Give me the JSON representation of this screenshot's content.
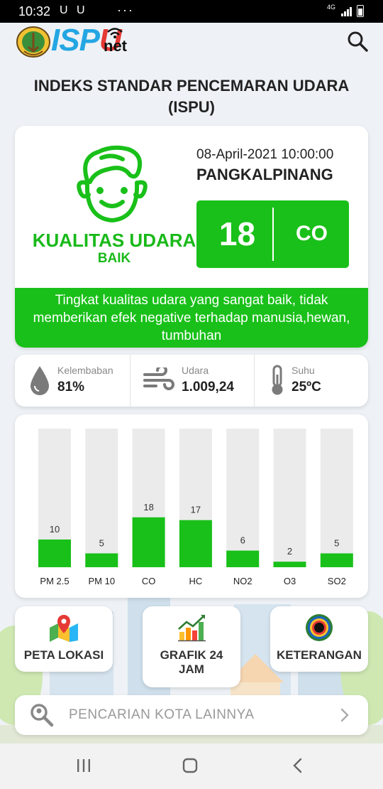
{
  "status_bar": {
    "time": "10:32",
    "indicators": "U U",
    "more": "···",
    "network": "4G"
  },
  "app": {
    "logo_text_1": "ISP",
    "logo_text_2": "U",
    "logo_suffix": "net",
    "search_icon": "search-icon"
  },
  "page_title": "INDEKS STANDAR PENCEMARAN UDARA (ISPU)",
  "air_quality": {
    "label": "KUALITAS UDARA",
    "category": "BAIK",
    "datetime": "08-April-2021 10:00:00",
    "city": "PANGKALPINANG",
    "ispu_value": "18",
    "dominant_param": "CO",
    "description": "Tingkat kualitas udara yang sangat baik, tidak memberikan efek negative terhadap manusia,hewan, tumbuhan",
    "status_color": "#19c019"
  },
  "weather": {
    "humidity_label": "Kelembaban",
    "humidity_value": "81%",
    "pressure_label": "Udara",
    "pressure_value": "1.009,24",
    "temp_label": "Suhu",
    "temp_value": "25ºC"
  },
  "chart_data": {
    "type": "bar",
    "categories": [
      "PM 2.5",
      "PM 10",
      "CO",
      "HC",
      "NO2",
      "O3",
      "SO2"
    ],
    "values": [
      10,
      5,
      18,
      17,
      6,
      2,
      5
    ],
    "ylim": [
      0,
      50
    ],
    "bar_color": "#19c019",
    "track_color": "#ebebeb",
    "title": "",
    "xlabel": "",
    "ylabel": ""
  },
  "actions": {
    "map_label": "PETA LOKASI",
    "graph_label_1": "GRAFIK 24",
    "graph_label_2": "JAM",
    "info_label": "KETERANGAN"
  },
  "search": {
    "placeholder": "PENCARIAN KOTA LAINNYA"
  }
}
